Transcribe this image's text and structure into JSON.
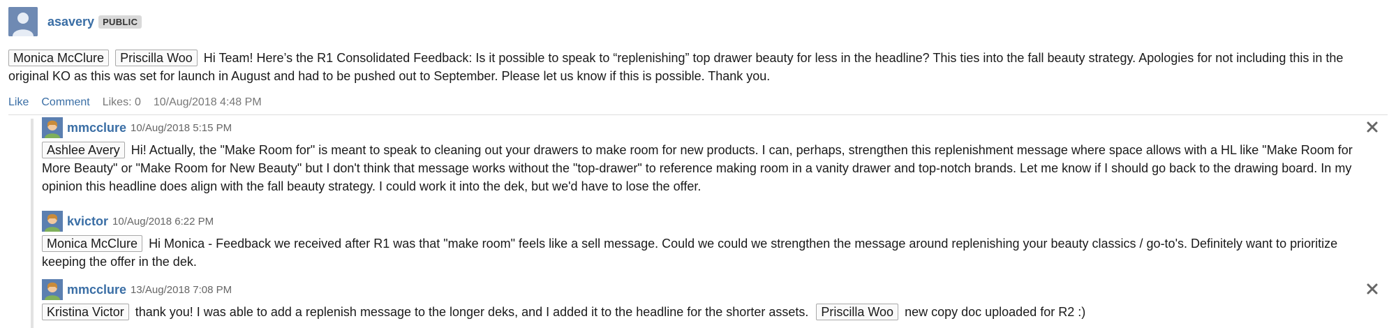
{
  "post": {
    "author": "asavery",
    "visibility": "PUBLIC",
    "mentions": [
      "Monica McClure",
      "Priscilla Woo"
    ],
    "text": "Hi Team! Here’s the R1 Consolidated Feedback: Is it possible to speak to “replenishing” top drawer beauty for less in the headline? This ties into the fall beauty strategy. Apologies for not including this in the original KO as this was set for launch in August and had to be pushed out to September. Please let us know if this is possible. Thank you.",
    "actions": {
      "like": "Like",
      "comment": "Comment",
      "likes": "Likes: 0",
      "timestamp": "10/Aug/2018 4:48 PM"
    }
  },
  "comments": [
    {
      "author": "mmcclure",
      "timestamp": "10/Aug/2018 5:15 PM",
      "mention": "Ashlee Avery",
      "text": "Hi! Actually, the \"Make Room for\" is meant to speak to cleaning out your drawers to make room for new products. I can, perhaps, strengthen this replenishment message where space allows with a HL like \"Make Room for More Beauty\" or \"Make Room for New Beauty\" but I don't think that message works without the \"top-drawer\" to reference making room in a vanity drawer and top-notch brands. Let me know if I should go back to the drawing board. In my opinion this headline does align with the fall beauty strategy. I could work it into the dek, but we'd have to lose the offer."
    },
    {
      "author": "kvictor",
      "timestamp": "10/Aug/2018 6:22 PM",
      "mention": "Monica McClure",
      "text": "Hi Monica - Feedback we received after R1 was that \"make room\" feels like a sell message. Could we could we strengthen the message around replenishing your beauty classics / go-to's. Definitely want to prioritize keeping the offer in the dek."
    },
    {
      "author": "mmcclure",
      "timestamp": "13/Aug/2018 7:08 PM",
      "mention": "Kristina Victor",
      "text": "thank you! I was able to add a replenish message to the longer deks, and I added it to the headline for the shorter assets.",
      "mention2": "Priscilla Woo",
      "text2": "new copy doc uploaded for R2 :)"
    }
  ],
  "icons": {
    "close": "close-icon",
    "avatar": "avatar-icon"
  },
  "colors": {
    "link": "#3a6ea5",
    "avatar_bg": "#6f8ab3"
  }
}
